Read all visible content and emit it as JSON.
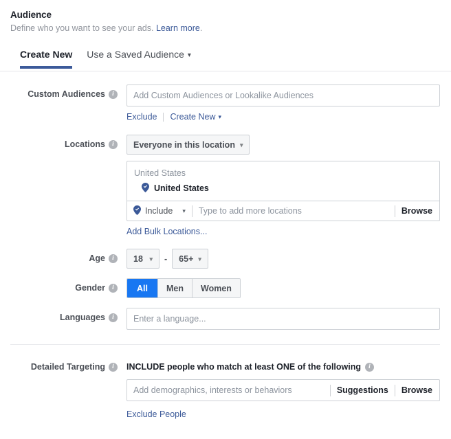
{
  "header": {
    "title": "Audience",
    "subtitle": "Define who you want to see your ads.",
    "learn_more": "Learn more",
    "period": "."
  },
  "tabs": [
    {
      "label": "Create New",
      "active": true
    },
    {
      "label": "Use a Saved Audience",
      "active": false,
      "caret": "▾"
    }
  ],
  "custom_audiences": {
    "label": "Custom Audiences",
    "placeholder": "Add Custom Audiences or Lookalike Audiences",
    "value": "",
    "links": {
      "exclude": "Exclude",
      "create_new": "Create New",
      "caret": "▾"
    }
  },
  "locations": {
    "label": "Locations",
    "scope_button": "Everyone in this location",
    "scope_caret": "▾",
    "group_header": "United States",
    "selected": [
      {
        "name": "United States",
        "icon": "location-pin-icon"
      }
    ],
    "include_label": "Include",
    "include_caret": "▾",
    "input_placeholder": "Type to add more locations",
    "browse_label": "Browse",
    "bulk_link": "Add Bulk Locations..."
  },
  "age": {
    "label": "Age",
    "min": "18",
    "max": "65+",
    "separator": "-",
    "caret": "▾"
  },
  "gender": {
    "label": "Gender",
    "options": [
      {
        "label": "All",
        "selected": true
      },
      {
        "label": "Men",
        "selected": false
      },
      {
        "label": "Women",
        "selected": false
      }
    ]
  },
  "languages": {
    "label": "Languages",
    "placeholder": "Enter a language...",
    "value": ""
  },
  "detailed_targeting": {
    "label": "Detailed Targeting",
    "heading": "INCLUDE people who match at least ONE of the following",
    "placeholder": "Add demographics, interests or behaviors",
    "suggestions_label": "Suggestions",
    "browse_label": "Browse",
    "exclude_link": "Exclude People"
  },
  "colors": {
    "accent_blue": "#1877f2",
    "link_blue": "#3b5998",
    "tab_underline": "#3c5a9a",
    "border": "#ccd0d5",
    "muted_text": "#8d949e",
    "label_text": "#4b4f56"
  }
}
